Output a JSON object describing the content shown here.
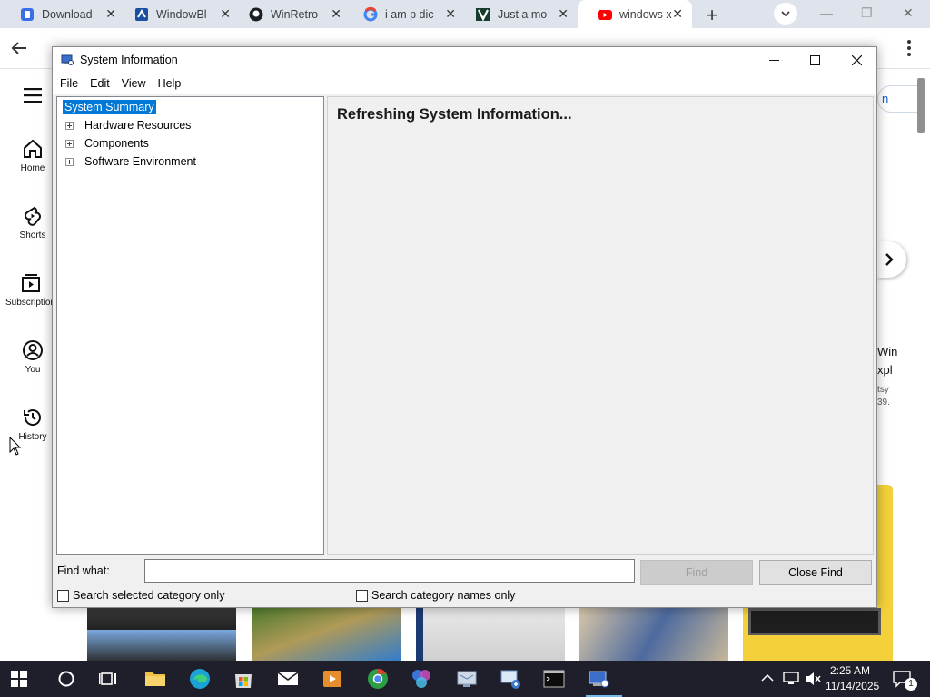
{
  "browser": {
    "tabs": [
      {
        "title": "Download",
        "favicon": "docs-blue-icon",
        "close": "✕"
      },
      {
        "title": "WindowBl",
        "favicon": "windowblinds-icon",
        "close": "✕"
      },
      {
        "title": "WinRetro",
        "favicon": "github-icon",
        "close": "✕"
      },
      {
        "title": "i am p dic",
        "favicon": "google-icon",
        "close": "✕"
      },
      {
        "title": "Just a mo",
        "favicon": "v-logo-icon",
        "close": "✕"
      },
      {
        "title": "windows x",
        "favicon": "youtube-icon",
        "close": "✕"
      }
    ],
    "new_tab": "+",
    "window_controls": [
      "—",
      "❐",
      "✕"
    ]
  },
  "youtube": {
    "nav": [
      {
        "label": "Home",
        "icon": "home-icon"
      },
      {
        "label": "Shorts",
        "icon": "shorts-icon"
      },
      {
        "label": "Subscriptions",
        "icon": "subscriptions-icon"
      },
      {
        "label": "You",
        "icon": "you-icon"
      },
      {
        "label": "History",
        "icon": "history-icon"
      }
    ],
    "sign_in_fragment": "n",
    "right_text": [
      "Win",
      "xpl",
      "tsy",
      "39."
    ]
  },
  "window": {
    "title": "System Information",
    "menu": [
      "File",
      "Edit",
      "View",
      "Help"
    ],
    "tree": [
      {
        "label": "System Summary",
        "selected": true,
        "expandable": false
      },
      {
        "label": "Hardware Resources",
        "selected": false,
        "expandable": true
      },
      {
        "label": "Components",
        "selected": false,
        "expandable": true
      },
      {
        "label": "Software Environment",
        "selected": false,
        "expandable": true
      }
    ],
    "status_message": "Refreshing System Information...",
    "find": {
      "label": "Find what:",
      "value": "",
      "find_button": "Find",
      "close_button": "Close Find",
      "checkbox_selected": "Search selected category only",
      "checkbox_names": "Search category names only"
    }
  },
  "taskbar": {
    "time": "2:25 AM",
    "date": "11/14/2025",
    "notification_count": "1",
    "accent": "#76b9ed"
  }
}
